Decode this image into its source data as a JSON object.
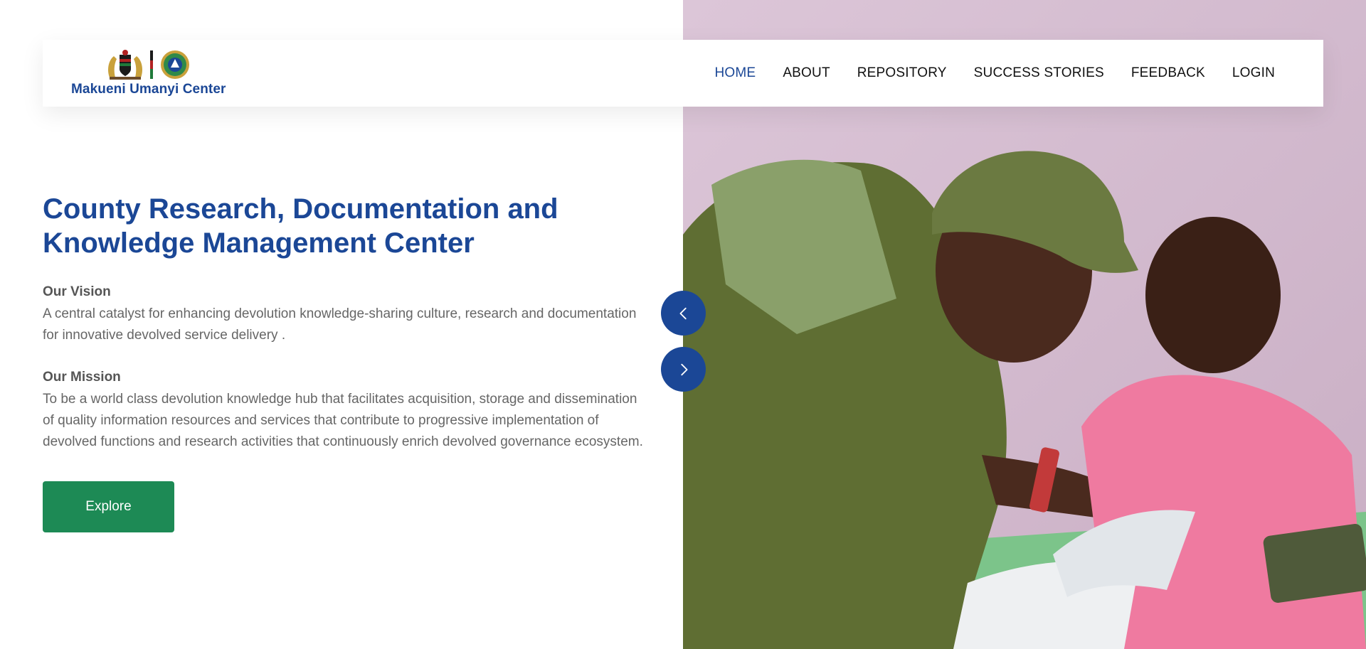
{
  "brand": {
    "name": "Makueni Umanyi Center"
  },
  "nav": {
    "items": [
      {
        "label": "HOME",
        "active": true
      },
      {
        "label": "ABOUT",
        "active": false
      },
      {
        "label": "REPOSITORY",
        "active": false
      },
      {
        "label": "SUCCESS STORIES",
        "active": false
      },
      {
        "label": "FEEDBACK",
        "active": false
      },
      {
        "label": "LOGIN",
        "active": false
      }
    ]
  },
  "hero": {
    "title": "County Research, Documentation and Knowledge Management Center",
    "vision_label": "Our Vision",
    "vision_text": "A central catalyst for enhancing devolution knowledge-sharing culture, research and documentation for innovative devolved service delivery .",
    "mission_label": "Our Mission",
    "mission_text": "To be a world class devolution knowledge hub that facilitates acquisition, storage and dissemination of quality information resources and services that contribute to progressive implementation of devolved functions and research activities that continuously enrich devolved governance ecosystem.",
    "cta_label": "Explore"
  },
  "carousel": {
    "prev_icon": "chevron-left-icon",
    "next_icon": "chevron-right-icon"
  },
  "colors": {
    "brand_blue": "#1b4796",
    "cta_green": "#1d8a55",
    "body_text": "#666666"
  }
}
